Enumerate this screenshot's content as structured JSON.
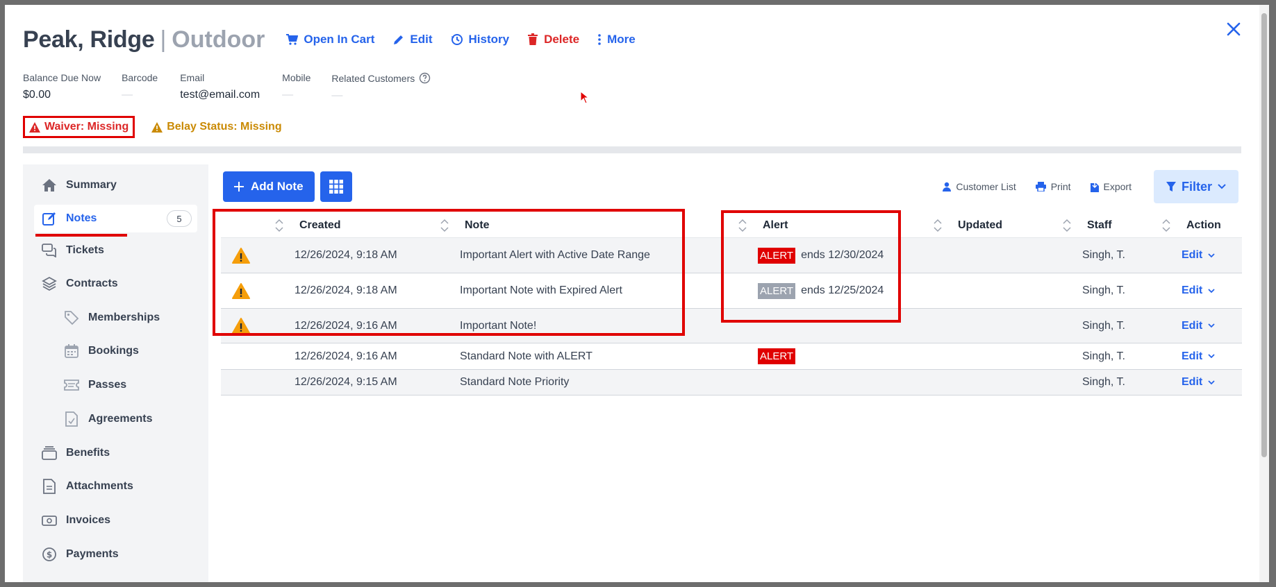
{
  "header": {
    "name": "Peak, Ridge",
    "separator": "|",
    "facility": "Outdoor",
    "actions": {
      "open_in_cart": "Open In Cart",
      "edit": "Edit",
      "history": "History",
      "delete": "Delete",
      "more": "More"
    }
  },
  "info": {
    "balance_label": "Balance Due Now",
    "balance_value": "$0.00",
    "barcode_label": "Barcode",
    "barcode_value": "—",
    "email_label": "Email",
    "email_value": "test@email.com",
    "mobile_label": "Mobile",
    "mobile_value": "—",
    "related_label": "Related Customers",
    "related_value": "—"
  },
  "statuses": {
    "waiver": "Waiver: Missing",
    "belay": "Belay Status: Missing"
  },
  "sidebar": {
    "items": [
      {
        "label": "Summary"
      },
      {
        "label": "Notes",
        "count": "5"
      },
      {
        "label": "Tickets"
      },
      {
        "label": "Contracts"
      },
      {
        "label": "Memberships"
      },
      {
        "label": "Bookings"
      },
      {
        "label": "Passes"
      },
      {
        "label": "Agreements"
      },
      {
        "label": "Benefits"
      },
      {
        "label": "Attachments"
      },
      {
        "label": "Invoices"
      },
      {
        "label": "Payments"
      }
    ]
  },
  "toolbar": {
    "add_note": "Add Note",
    "customer_list": "Customer List",
    "print": "Print",
    "export": "Export",
    "filter": "Filter"
  },
  "table": {
    "headers": {
      "created": "Created",
      "note": "Note",
      "alert": "Alert",
      "updated": "Updated",
      "staff": "Staff",
      "action": "Action"
    },
    "rows": [
      {
        "created": "12/26/2024, 9:18 AM",
        "note": "Important Alert with Active Date Range",
        "alert_tag": "ALERT",
        "alert_ends": "ends 12/30/2024",
        "staff": "Singh, T.",
        "action": "Edit"
      },
      {
        "created": "12/26/2024, 9:18 AM",
        "note": "Important Note with Expired Alert",
        "alert_tag": "ALERT",
        "alert_ends": "ends 12/25/2024",
        "staff": "Singh, T.",
        "action": "Edit"
      },
      {
        "created": "12/26/2024, 9:16 AM",
        "note": "Important Note!",
        "staff": "Singh, T.",
        "action": "Edit"
      },
      {
        "created": "12/26/2024, 9:16 AM",
        "note": "Standard Note with ALERT",
        "alert_tag": "ALERT",
        "staff": "Singh, T.",
        "action": "Edit"
      },
      {
        "created": "12/26/2024, 9:15 AM",
        "note": "Standard Note Priority",
        "staff": "Singh, T.",
        "action": "Edit"
      }
    ]
  },
  "colors": {
    "accent": "#2563eb",
    "danger": "#dc2626",
    "warning": "#f59e0b",
    "highlight": "#e00000",
    "alert_active": "#e00000",
    "alert_expired": "#9ca3af"
  }
}
